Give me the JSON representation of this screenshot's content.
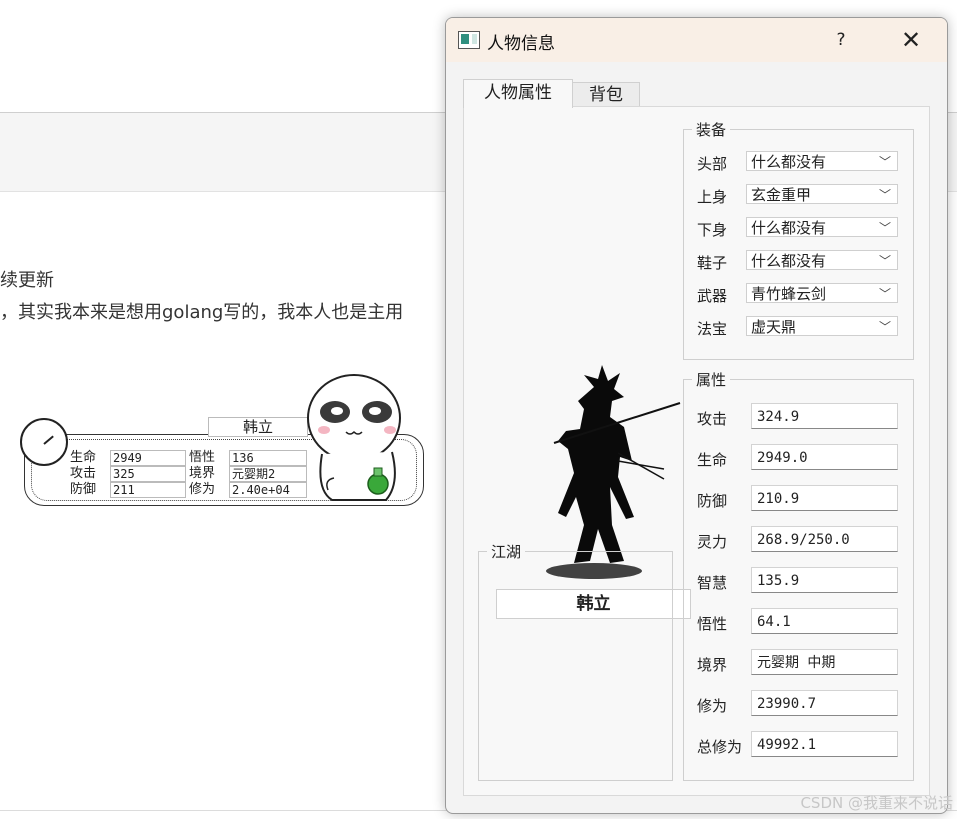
{
  "background_page": {
    "line1": "续更新",
    "line2": "，其实我本来是想用golang写的，我本人也是主用"
  },
  "watermark": "CSDN @我重来不说话",
  "pet_widget": {
    "name": "韩立",
    "stats": [
      {
        "label": "生命",
        "value": "2949"
      },
      {
        "label": "悟性",
        "value": "136"
      },
      {
        "label": "攻击",
        "value": "325"
      },
      {
        "label": "境界",
        "value": "元婴期2"
      },
      {
        "label": "防御",
        "value": "211"
      },
      {
        "label": "修为",
        "value": "2.40e+04"
      }
    ]
  },
  "dialog": {
    "title": "人物信息",
    "help_label": "?",
    "close_label": "✕",
    "tabs": [
      {
        "label": "人物属性",
        "active": true
      },
      {
        "label": "背包",
        "active": false
      }
    ],
    "character_name": "韩立",
    "jianghu_group_title": "江湖",
    "equipment": {
      "title": "装备",
      "slots": [
        {
          "label": "头部",
          "value": "什么都没有"
        },
        {
          "label": "上身",
          "value": "玄金重甲"
        },
        {
          "label": "下身",
          "value": "什么都没有"
        },
        {
          "label": "鞋子",
          "value": "什么都没有"
        },
        {
          "label": "武器",
          "value": "青竹蜂云剑"
        },
        {
          "label": "法宝",
          "value": "虚天鼎"
        }
      ]
    },
    "attributes": {
      "title": "属性",
      "fields": [
        {
          "label": "攻击",
          "value": "324.9"
        },
        {
          "label": "生命",
          "value": "2949.0"
        },
        {
          "label": "防御",
          "value": "210.9"
        },
        {
          "label": "灵力",
          "value": "268.9/250.0"
        },
        {
          "label": "智慧",
          "value": "135.9"
        },
        {
          "label": "悟性",
          "value": "64.1"
        },
        {
          "label": "境界",
          "value": "元婴期 中期"
        },
        {
          "label": "修为",
          "value": "23990.7"
        },
        {
          "label": "总修为",
          "value": "49992.1"
        }
      ]
    }
  }
}
